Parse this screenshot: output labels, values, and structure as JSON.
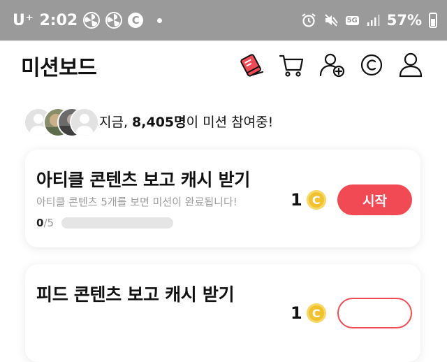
{
  "status_bar": {
    "carrier": "U⁺",
    "time": "2:02",
    "battery": "57%",
    "network_badge": "5G",
    "icons": [
      "fan-icon",
      "fan-icon",
      "coin-c-icon",
      "notification-dot",
      "alarm-icon",
      "mute-icon",
      "5g-icon",
      "signal-icon",
      "battery-icon"
    ]
  },
  "header": {
    "title": "미션보드",
    "icons": [
      "shoe-icon",
      "cart-icon",
      "add-friend-icon",
      "cash-coin-icon",
      "profile-icon"
    ]
  },
  "participants": {
    "prefix": "지금, ",
    "count": "8,405명",
    "suffix": "이 미션 참여중!"
  },
  "missions": [
    {
      "title": "아티클 콘텐츠 보고 캐시 받기",
      "subtitle": "아티클 콘텐츠 5개를 보면 미션이 완료됩니다!",
      "progress_current": "0",
      "progress_total": "/5",
      "progress_fraction": 0,
      "reward": "1",
      "reward_coin": "C",
      "button": "시작"
    },
    {
      "title": "피드 콘텐츠 보고 캐시 받기",
      "reward": "1",
      "reward_coin": "C"
    }
  ],
  "colors": {
    "status_bar": "#9a9a9a",
    "accent": "#f24a55",
    "coin": "#f2c12e"
  }
}
